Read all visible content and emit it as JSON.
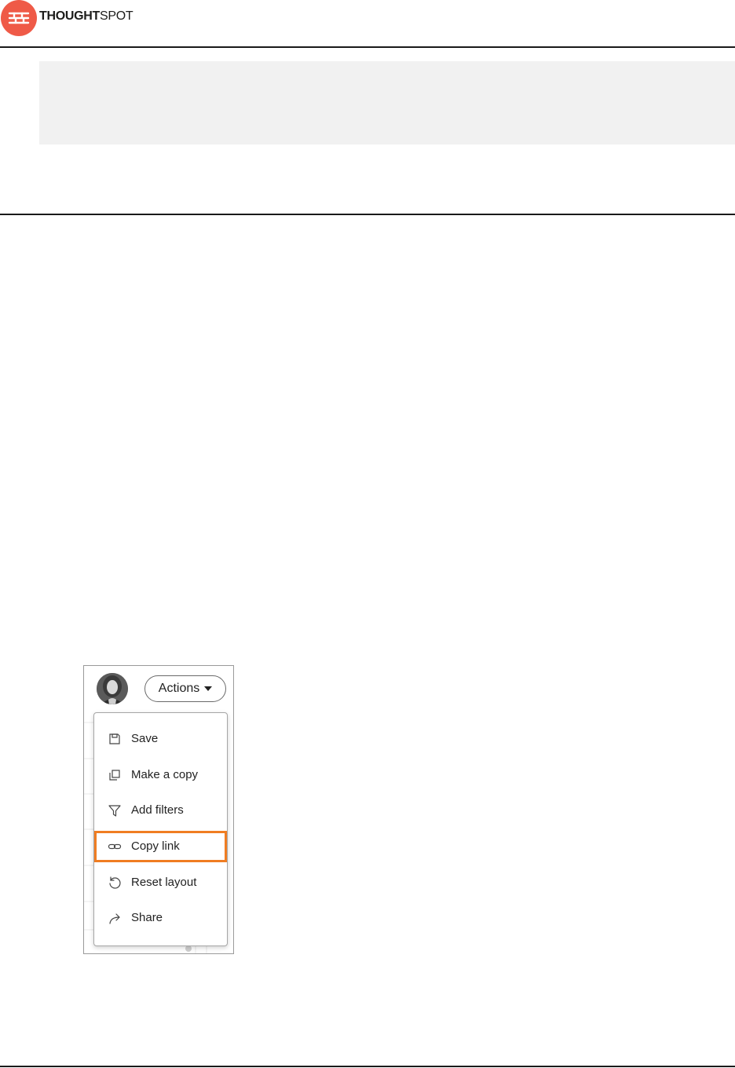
{
  "header": {
    "brand_bold": "THOUGHT",
    "brand_light": "SPOT",
    "logo_icon": "thoughtspot-logo-icon"
  },
  "screenshot": {
    "actions_label": "Actions",
    "menu_items": [
      {
        "label": "Save",
        "icon": "save-icon"
      },
      {
        "label": "Make a copy",
        "icon": "copy-icon"
      },
      {
        "label": "Add filters",
        "icon": "filter-icon"
      },
      {
        "label": "Copy link",
        "icon": "link-icon",
        "highlighted": true
      },
      {
        "label": "Reset layout",
        "icon": "reset-icon"
      },
      {
        "label": "Share",
        "icon": "share-icon"
      }
    ],
    "highlight_color": "#f07d22"
  },
  "colors": {
    "brand": "#ef5a47",
    "rule": "#1a1a1a",
    "callout_bg": "#f1f1f1"
  }
}
